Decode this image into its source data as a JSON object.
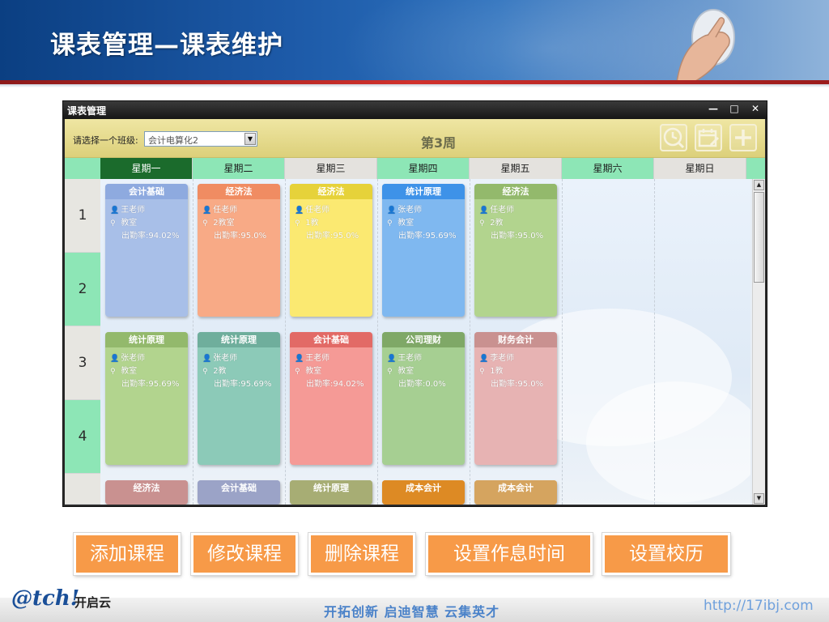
{
  "banner": {
    "title": "课表管理—课表维护"
  },
  "window": {
    "title": "课表管理",
    "controls": {
      "minimize": "—",
      "maximize": "□",
      "close": "✕"
    }
  },
  "toolbar": {
    "class_label": "请选择一个班级:",
    "class_value": "会计电算化2",
    "week": "第3周",
    "icons": [
      "clock-icon",
      "calendar-edit-icon",
      "plus-icon"
    ]
  },
  "days": [
    "星期一",
    "星期二",
    "星期三",
    "星期四",
    "星期五",
    "星期六",
    "星期日"
  ],
  "periods": [
    "1",
    "2",
    "3",
    "4"
  ],
  "courses": {
    "r1": [
      {
        "name": "会计基础",
        "teacher": "王老师",
        "room": "教室",
        "rate": "出勤率:94.02%"
      },
      {
        "name": "经济法",
        "teacher": "任老师",
        "room": "2教室",
        "rate": "出勤率:95.0%"
      },
      {
        "name": "经济法",
        "teacher": "任老师",
        "room": "1教",
        "rate": "出勤率:95.0%"
      },
      {
        "name": "统计原理",
        "teacher": "张老师",
        "room": "教室",
        "rate": "出勤率:95.69%"
      },
      {
        "name": "经济法",
        "teacher": "任老师",
        "room": "2教",
        "rate": "出勤率:95.0%"
      }
    ],
    "r2": [
      {
        "name": "统计原理",
        "teacher": "张老师",
        "room": "教室",
        "rate": "出勤率:95.69%"
      },
      {
        "name": "统计原理",
        "teacher": "张老师",
        "room": "2教",
        "rate": "出勤率:95.69%"
      },
      {
        "name": "会计基础",
        "teacher": "王老师",
        "room": "教室",
        "rate": "出勤率:94.02%"
      },
      {
        "name": "公司理财",
        "teacher": "王老师",
        "room": "教室",
        "rate": "出勤率:0.0%"
      },
      {
        "name": "财务会计",
        "teacher": "李老师",
        "room": "1教",
        "rate": "出勤率:95.0%"
      }
    ],
    "r3": [
      {
        "name": "经济法"
      },
      {
        "name": "会计基础"
      },
      {
        "name": "统计原理"
      },
      {
        "name": "成本会计"
      },
      {
        "name": "成本会计"
      }
    ]
  },
  "card_colors": {
    "r1": [
      [
        "#8eaadf",
        "#a8bfe8"
      ],
      [
        "#f08c62",
        "#f8aa86"
      ],
      [
        "#e6d23a",
        "#fbe971"
      ],
      [
        "#3e92e8",
        "#7fb8f0"
      ],
      [
        "#93b96c",
        "#b2d48e"
      ]
    ],
    "r2": [
      [
        "#93b96c",
        "#b2d48e"
      ],
      [
        "#6fae9c",
        "#8ccab8"
      ],
      [
        "#e26a66",
        "#f59a96"
      ],
      [
        "#7fa867",
        "#a6cf92"
      ],
      [
        "#c99190",
        "#e7b3b3"
      ]
    ],
    "r3": [
      "#c99190",
      "#9ba3c7",
      "#a7ad74",
      "#dd8a24",
      "#d5a45f"
    ]
  },
  "actions": [
    "添加课程",
    "修改课程",
    "删除课程",
    "设置作息时间",
    "设置校历"
  ],
  "footer": {
    "logo_main": "@tch!",
    "logo_cn": "开启云",
    "slogan": "开拓创新  启迪智慧  云集英才",
    "url": "http://17ibj.com"
  }
}
